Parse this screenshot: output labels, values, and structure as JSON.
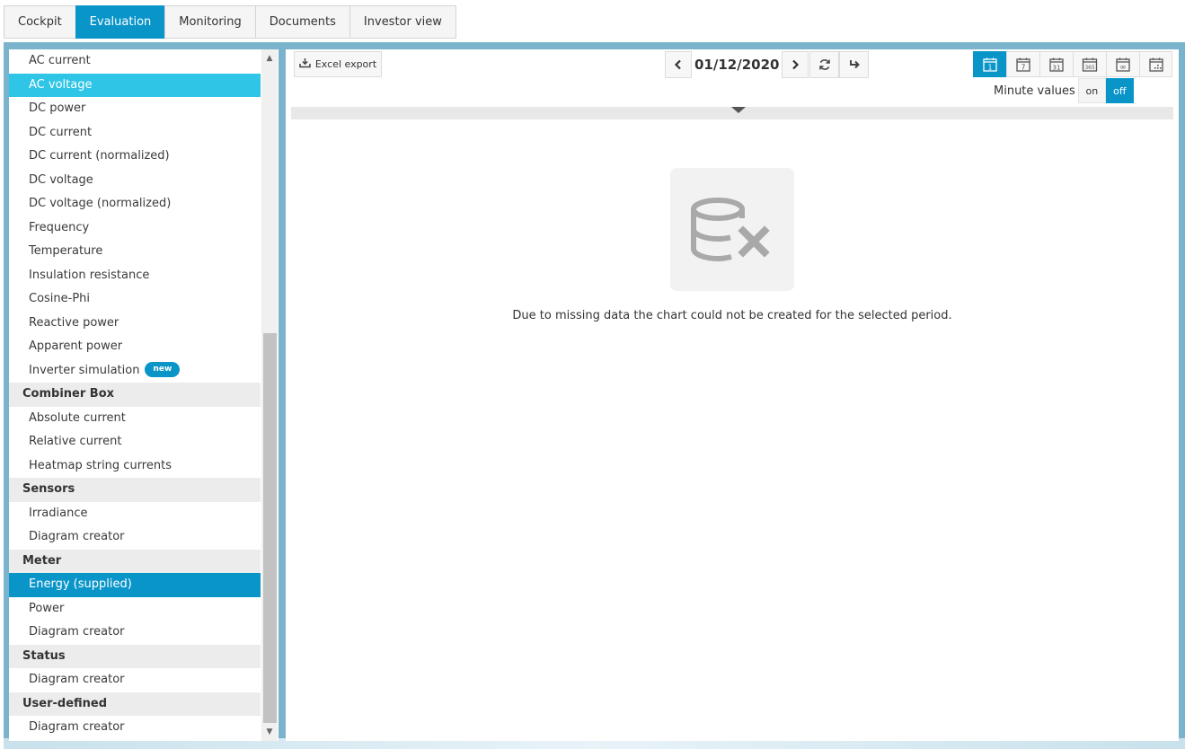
{
  "tabs": [
    {
      "label": "Cockpit",
      "active": false
    },
    {
      "label": "Evaluation",
      "active": true
    },
    {
      "label": "Monitoring",
      "active": false
    },
    {
      "label": "Documents",
      "active": false
    },
    {
      "label": "Investor view",
      "active": false
    }
  ],
  "sidebar": {
    "inverter_items": [
      "AC current",
      "AC voltage",
      "DC power",
      "DC current",
      "DC current (normalized)",
      "DC voltage",
      "DC voltage (normalized)",
      "Frequency",
      "Temperature",
      "Insulation resistance",
      "Cosine-Phi",
      "Reactive power",
      "Apparent power"
    ],
    "inverter_simulation": {
      "label": "Inverter simulation",
      "badge": "new"
    },
    "combiner_box": {
      "title": "Combiner Box",
      "items": [
        "Absolute current",
        "Relative current",
        "Heatmap string currents"
      ]
    },
    "sensors": {
      "title": "Sensors",
      "items": [
        "Irradiance",
        "Diagram creator"
      ]
    },
    "meter": {
      "title": "Meter",
      "items": [
        "Energy (supplied)",
        "Power",
        "Diagram creator"
      ]
    },
    "status": {
      "title": "Status",
      "items": [
        "Diagram creator"
      ]
    },
    "user_defined": {
      "title": "User-defined",
      "items": [
        "Diagram creator"
      ]
    },
    "hover_item": "AC voltage",
    "selected_item": "Energy (supplied)"
  },
  "toolbar": {
    "excel_export": "Excel export",
    "date": "01/12/2020",
    "period_icons": [
      "calendar-day-icon",
      "calendar-week-icon",
      "calendar-month-icon",
      "calendar-year-icon",
      "calendar-total-icon",
      "calendar-custom-icon"
    ],
    "period_labels": [
      "1",
      "7",
      "31",
      "365",
      "∞",
      ""
    ],
    "active_period": "1",
    "minute_values_label": "Minute values",
    "toggle_on": "on",
    "toggle_off": "off",
    "minute_values_state": "off"
  },
  "empty_state": {
    "message": "Due to missing data the chart could not be created for the selected period.",
    "icon": "database-x-icon"
  },
  "colors": {
    "accent": "#0a95c9",
    "hover": "#2fc5e6",
    "frame": "#7ab4cc"
  }
}
